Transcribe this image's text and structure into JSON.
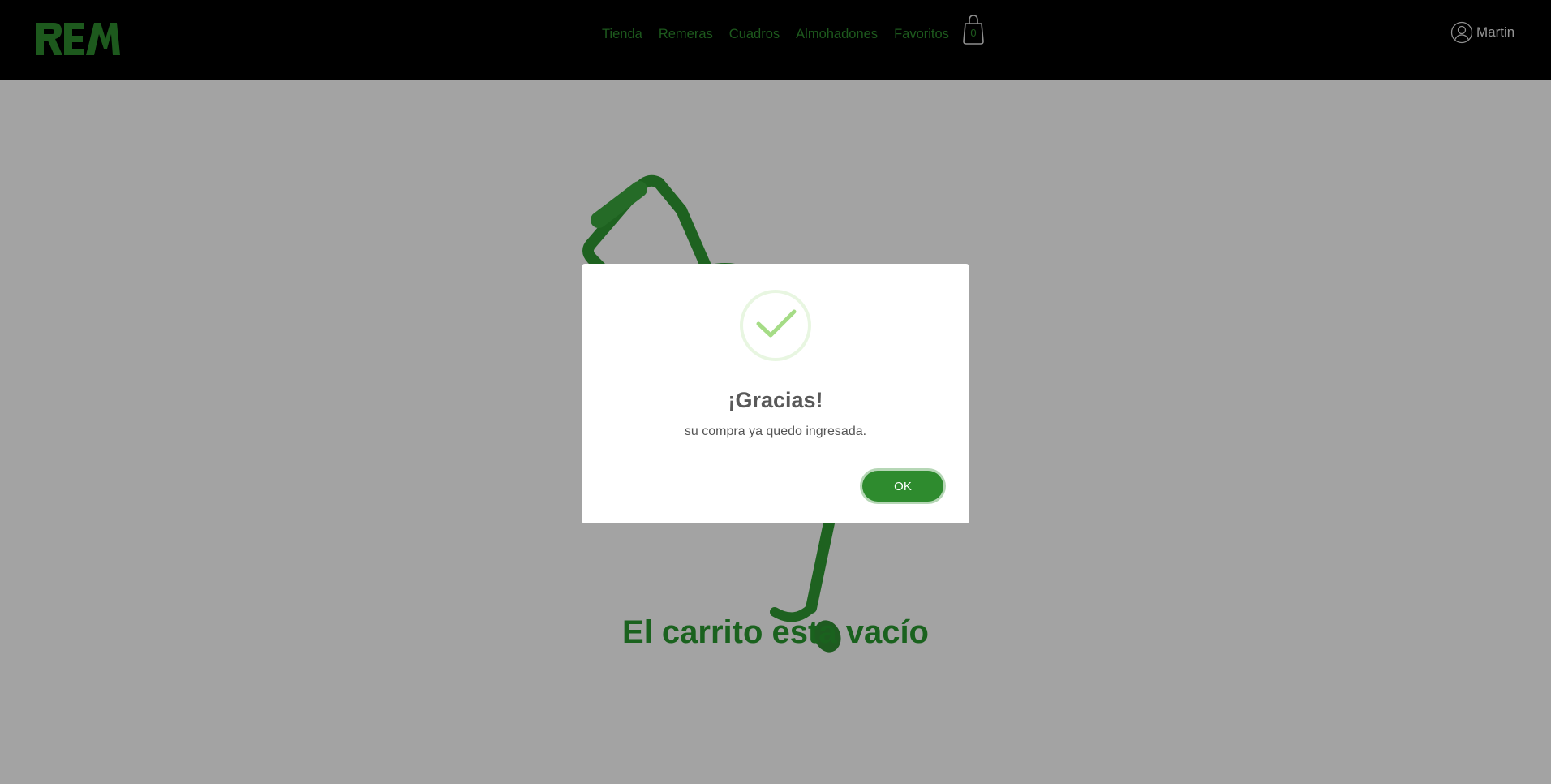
{
  "brand": {
    "logo_text": "REM"
  },
  "nav": {
    "links": [
      "Tienda",
      "Remeras",
      "Cuadros",
      "Almohadones",
      "Favoritos"
    ],
    "cart_count": "0",
    "cart_icon": "shopping-bag-icon",
    "user_icon": "user-circle-icon",
    "user_name": "Martin"
  },
  "main": {
    "empty_cart_message": "El carrito esta vacío",
    "illustration": "empty-shopping-cart"
  },
  "modal": {
    "icon": "success-check-icon",
    "title": "¡Gracias!",
    "text": "su compra ya quedo ingresada.",
    "ok_label": "OK"
  },
  "colors": {
    "navbar_bg": "#000000",
    "accent_green": "#2e8b2e",
    "title_green": "#2a9a30",
    "success_green": "#a5dc86",
    "overlay": "rgba(0,0,0,0.36)"
  }
}
